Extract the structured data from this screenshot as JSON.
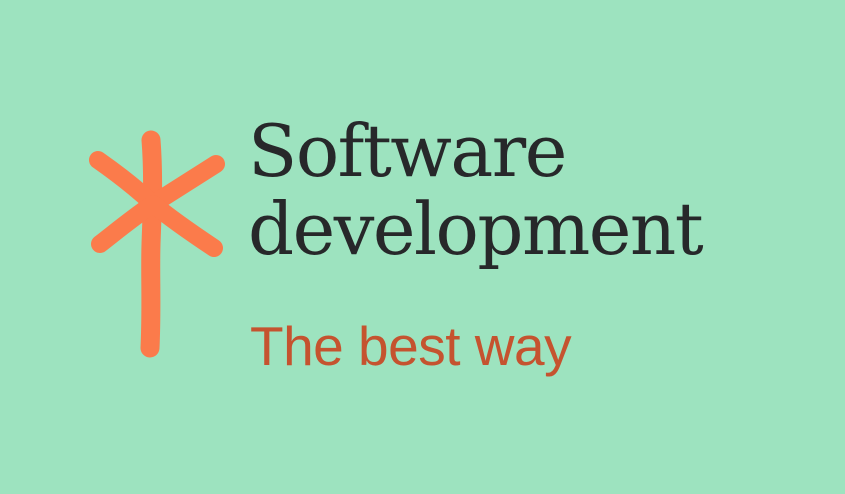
{
  "banner": {
    "title_line_1": "Software",
    "title_line_2": "development",
    "tagline": "The best way"
  },
  "logo": {
    "icon": "asterisk-stick-icon",
    "color": "#fb7b4b"
  },
  "colors": {
    "background": "#9de3bf",
    "title_text": "#27282a",
    "tagline_text": "#c5532f",
    "logo": "#fb7b4b"
  }
}
